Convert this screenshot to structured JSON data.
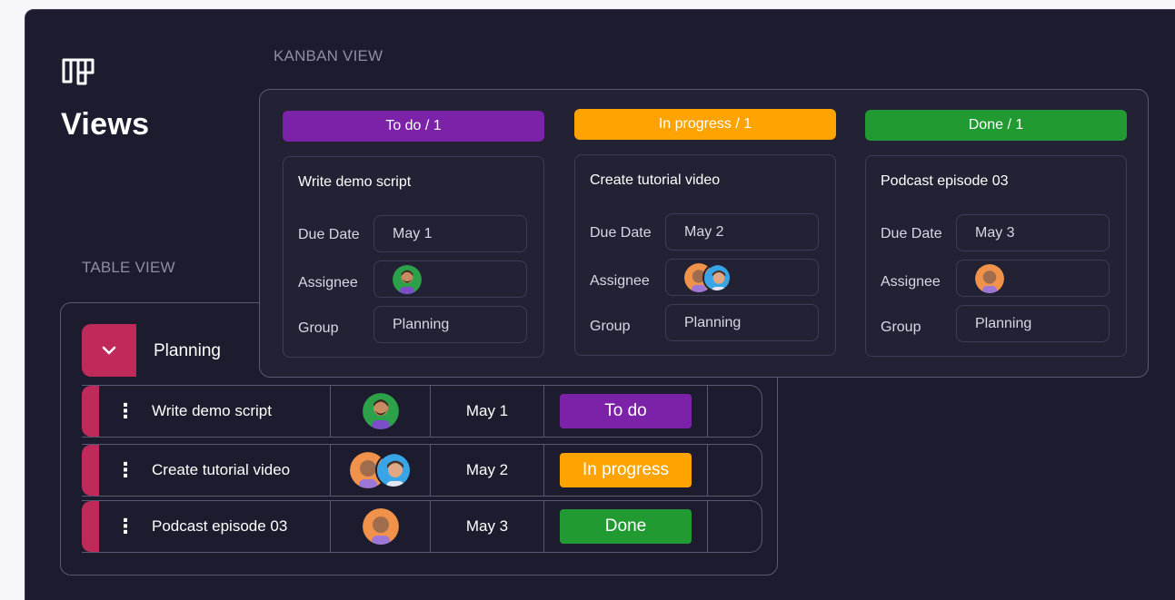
{
  "views_title": "Views",
  "kanban_label": "KANBAN VIEW",
  "table_label": "TABLE VIEW",
  "colors": {
    "panel_bg": "#1d1c2e",
    "todo": "#7b22a8",
    "in_progress": "#fea300",
    "done": "#229a32",
    "group": "#c02a5b"
  },
  "table": {
    "group_name": "Planning",
    "rows": [
      {
        "name": "Write demo script",
        "date": "May 1",
        "status": "To do",
        "status_key": "todo",
        "menu": "⋮"
      },
      {
        "name": "Create tutorial video",
        "date": "May 2",
        "status": "In progress",
        "status_key": "in_progress",
        "menu": "⋮"
      },
      {
        "name": "Podcast episode 03",
        "date": "May 3",
        "status": "Done",
        "status_key": "done",
        "menu": "⋮"
      }
    ]
  },
  "kanban": {
    "field_labels": {
      "due": "Due Date",
      "assignee": "Assignee",
      "group": "Group"
    },
    "columns": [
      {
        "header": "To do / 1",
        "card": {
          "title": "Write demo script",
          "due": "May 1",
          "group": "Planning"
        }
      },
      {
        "header": "In progress / 1",
        "card": {
          "title": "Create tutorial video",
          "due": "May 2",
          "group": "Planning"
        }
      },
      {
        "header": "Done / 1",
        "card": {
          "title": "Podcast episode 03",
          "due": "May 3",
          "group": "Planning"
        }
      }
    ]
  },
  "icons": {
    "logo": "board-logo-icon",
    "group_toggle": "chevron-down-icon",
    "row_menu": "vertical-dots-icon"
  }
}
